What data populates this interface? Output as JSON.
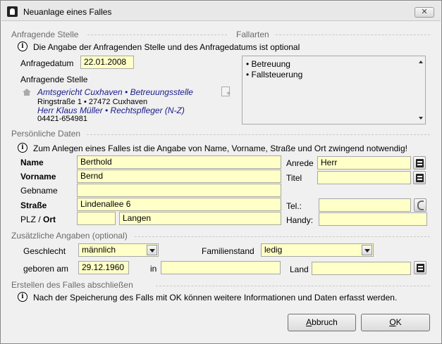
{
  "window": {
    "title": "Neuanlage eines Falles",
    "close_symbol": "✕"
  },
  "sections": {
    "anfragende_stelle": "Anfragende Stelle",
    "fallarten": "Fallarten",
    "persoenliche_daten": "Persönliche Daten",
    "zusaetzliche_angaben": "Zusätzliche Angaben (optional)",
    "erstellen": "Erstellen des Falles abschließen"
  },
  "anfragende": {
    "info": "Die Angabe der Anfragenden Stelle und des Anfragedatums ist optional",
    "datum_label": "Anfragedatum",
    "datum_value": "22.01.2008",
    "stelle_label": "Anfragende Stelle",
    "stelle_name": "Amtsgericht Cuxhaven • Betreuungsstelle",
    "stelle_address": "Ringstraße 1 • 27472 Cuxhaven",
    "contact_name": "Herr Klaus Müller • Rechtspfleger (N-Z)",
    "contact_phone": "04421-654981"
  },
  "fallarten": {
    "items": [
      "• Betreuung",
      "• Fallsteuerung"
    ]
  },
  "personal": {
    "info": "Zum Anlegen eines Falles ist die Angabe von Name, Vorname, Straße und Ort zwingend notwendig!",
    "name_label": "Name",
    "name_value": "Berthold",
    "vorname_label": "Vorname",
    "vorname_value": "Bernd",
    "gebname_label": "Gebname",
    "gebname_value": "",
    "strasse_label": "Straße",
    "strasse_value": "Lindenallee 6",
    "plz_label": "PLZ /",
    "ort_label": "Ort",
    "plz_value": "",
    "ort_value": "Langen",
    "anrede_label": "Anrede",
    "anrede_value": "Herr",
    "titel_label": "Titel",
    "titel_value": "",
    "tel_label": "Tel.:",
    "tel_value": "",
    "handy_label": "Handy:",
    "handy_value": ""
  },
  "extra": {
    "geschlecht_label": "Geschlecht",
    "geschlecht_value": "männlich",
    "familienstand_label": "Familienstand",
    "familienstand_value": "ledig",
    "geboren_label": "geboren am",
    "geboren_value": "29.12.1960",
    "in_label": "in",
    "in_value": "",
    "land_label": "Land",
    "land_value": ""
  },
  "finish": {
    "info": "Nach der Speicherung des Falls mit OK können weitere Informationen und Daten erfasst werden."
  },
  "buttons": {
    "abbruch_first": "A",
    "abbruch_rest": "bbruch",
    "ok_first": "O",
    "ok_rest": "K"
  },
  "icons": [
    "user-icon",
    "close-icon",
    "info-icon",
    "home-icon",
    "add-document-icon",
    "list-icon",
    "phone-icon",
    "dropdown-arrow-icon"
  ]
}
